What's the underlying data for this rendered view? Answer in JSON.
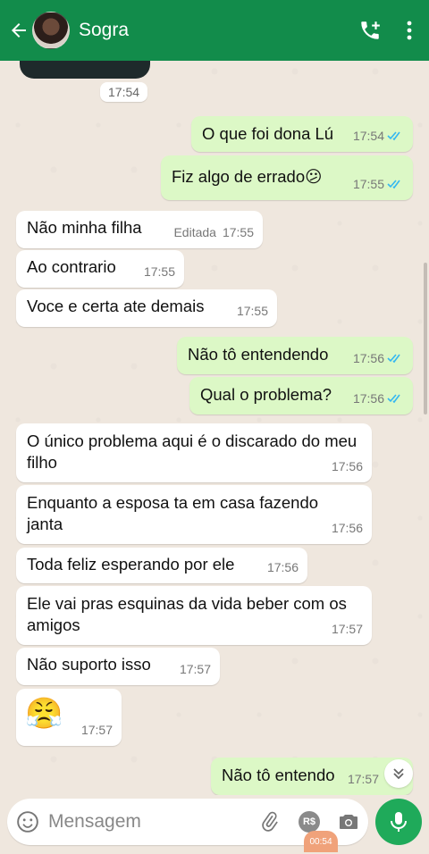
{
  "header": {
    "contact_name": "Sogra"
  },
  "chat": {
    "image_time": "17:54",
    "messages": [
      {
        "dir": "out",
        "text": "O que foi dona Lú",
        "time": "17:54",
        "read": true
      },
      {
        "dir": "out",
        "text": "Fiz algo de errado😕",
        "time": "17:55",
        "read": true
      },
      {
        "dir": "in",
        "text": "Não minha filha",
        "edited": "Editada",
        "time": "17:55"
      },
      {
        "dir": "in",
        "text": "Ao contrario",
        "time": "17:55"
      },
      {
        "dir": "in",
        "text": "Voce e certa ate demais",
        "time": "17:55"
      },
      {
        "dir": "out",
        "text": "Não tô entendendo",
        "time": "17:56",
        "read": true
      },
      {
        "dir": "out",
        "text": "Qual o problema?",
        "time": "17:56",
        "read": true
      },
      {
        "dir": "in",
        "text": "O único problema aqui é o discarado do meu filho",
        "time": "17:56"
      },
      {
        "dir": "in",
        "text": "Enquanto a esposa ta em casa fazendo janta",
        "time": "17:56"
      },
      {
        "dir": "in",
        "text": "Toda feliz esperando por ele",
        "time": "17:56"
      },
      {
        "dir": "in",
        "text": "Ele vai pras esquinas da vida beber com os amigos",
        "time": "17:57"
      },
      {
        "dir": "in",
        "text": "Não suporto isso",
        "time": "17:57"
      },
      {
        "dir": "in",
        "text": "😤",
        "time": "17:57"
      },
      {
        "dir": "out",
        "text": "Não tô entendo",
        "time": "17:57",
        "read": true
      }
    ]
  },
  "input": {
    "placeholder": "Mensagem",
    "currency_label": "R$",
    "recording_time": "00:54"
  },
  "colors": {
    "header": "#128c4b",
    "outgoing": "#dcf8c6",
    "incoming": "#ffffff",
    "tick_read": "#34b7f1"
  }
}
